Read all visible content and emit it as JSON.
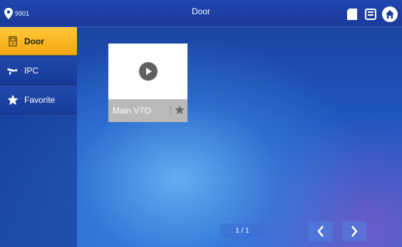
{
  "header": {
    "room_number": "9901",
    "title": "Door",
    "icons": [
      "location-pin-icon",
      "sim-card-icon",
      "memory-card-icon",
      "home-icon"
    ]
  },
  "sidebar": {
    "items": [
      {
        "label": "Door",
        "icon": "door-icon",
        "active": true
      },
      {
        "label": "IPC",
        "icon": "camera-icon",
        "active": false
      },
      {
        "label": "Favorite",
        "icon": "star-icon",
        "active": false
      }
    ]
  },
  "devices": [
    {
      "label": "Main VTO",
      "icon": "play-icon",
      "favorite_icon": "star-icon"
    }
  ],
  "pager": {
    "text": "1 / 1"
  },
  "colors": {
    "active_tab": "#f2a70f",
    "background": "#1f58c0",
    "tile_footer": "#b9b9b9"
  }
}
